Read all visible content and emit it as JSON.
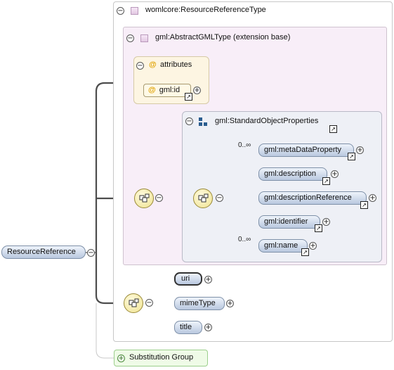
{
  "root": {
    "label": "ResourceReference"
  },
  "type_header": {
    "label": "womlcore:ResourceReferenceType"
  },
  "extension": {
    "label": "gml:AbstractGMLType (extension base)"
  },
  "attributes_group": {
    "label": "attributes",
    "at_symbol": "@",
    "items": [
      {
        "label": "gml:id"
      }
    ]
  },
  "group_ref": {
    "label": "gml:StandardObjectProperties"
  },
  "group_elements": [
    {
      "label": "gml:metaDataProperty",
      "occurs": "0..∞"
    },
    {
      "label": "gml:description",
      "occurs": ""
    },
    {
      "label": "gml:descriptionReference",
      "occurs": ""
    },
    {
      "label": "gml:identifier",
      "occurs": ""
    },
    {
      "label": "gml:name",
      "occurs": "0..∞"
    }
  ],
  "local_elements": [
    {
      "label": "uri"
    },
    {
      "label": "mimeType"
    },
    {
      "label": "title"
    }
  ],
  "substitution": {
    "label": "Substitution Group"
  },
  "symbols": {
    "collapse": "−",
    "expand": "+",
    "link": "↗"
  },
  "colors": {
    "element_fill": "#c7d3e6",
    "extension_fill": "#f8eef8",
    "attributes_fill": "#fdf5e2",
    "group_fill": "#eef0f6",
    "substitution_fill": "#effbe7"
  }
}
